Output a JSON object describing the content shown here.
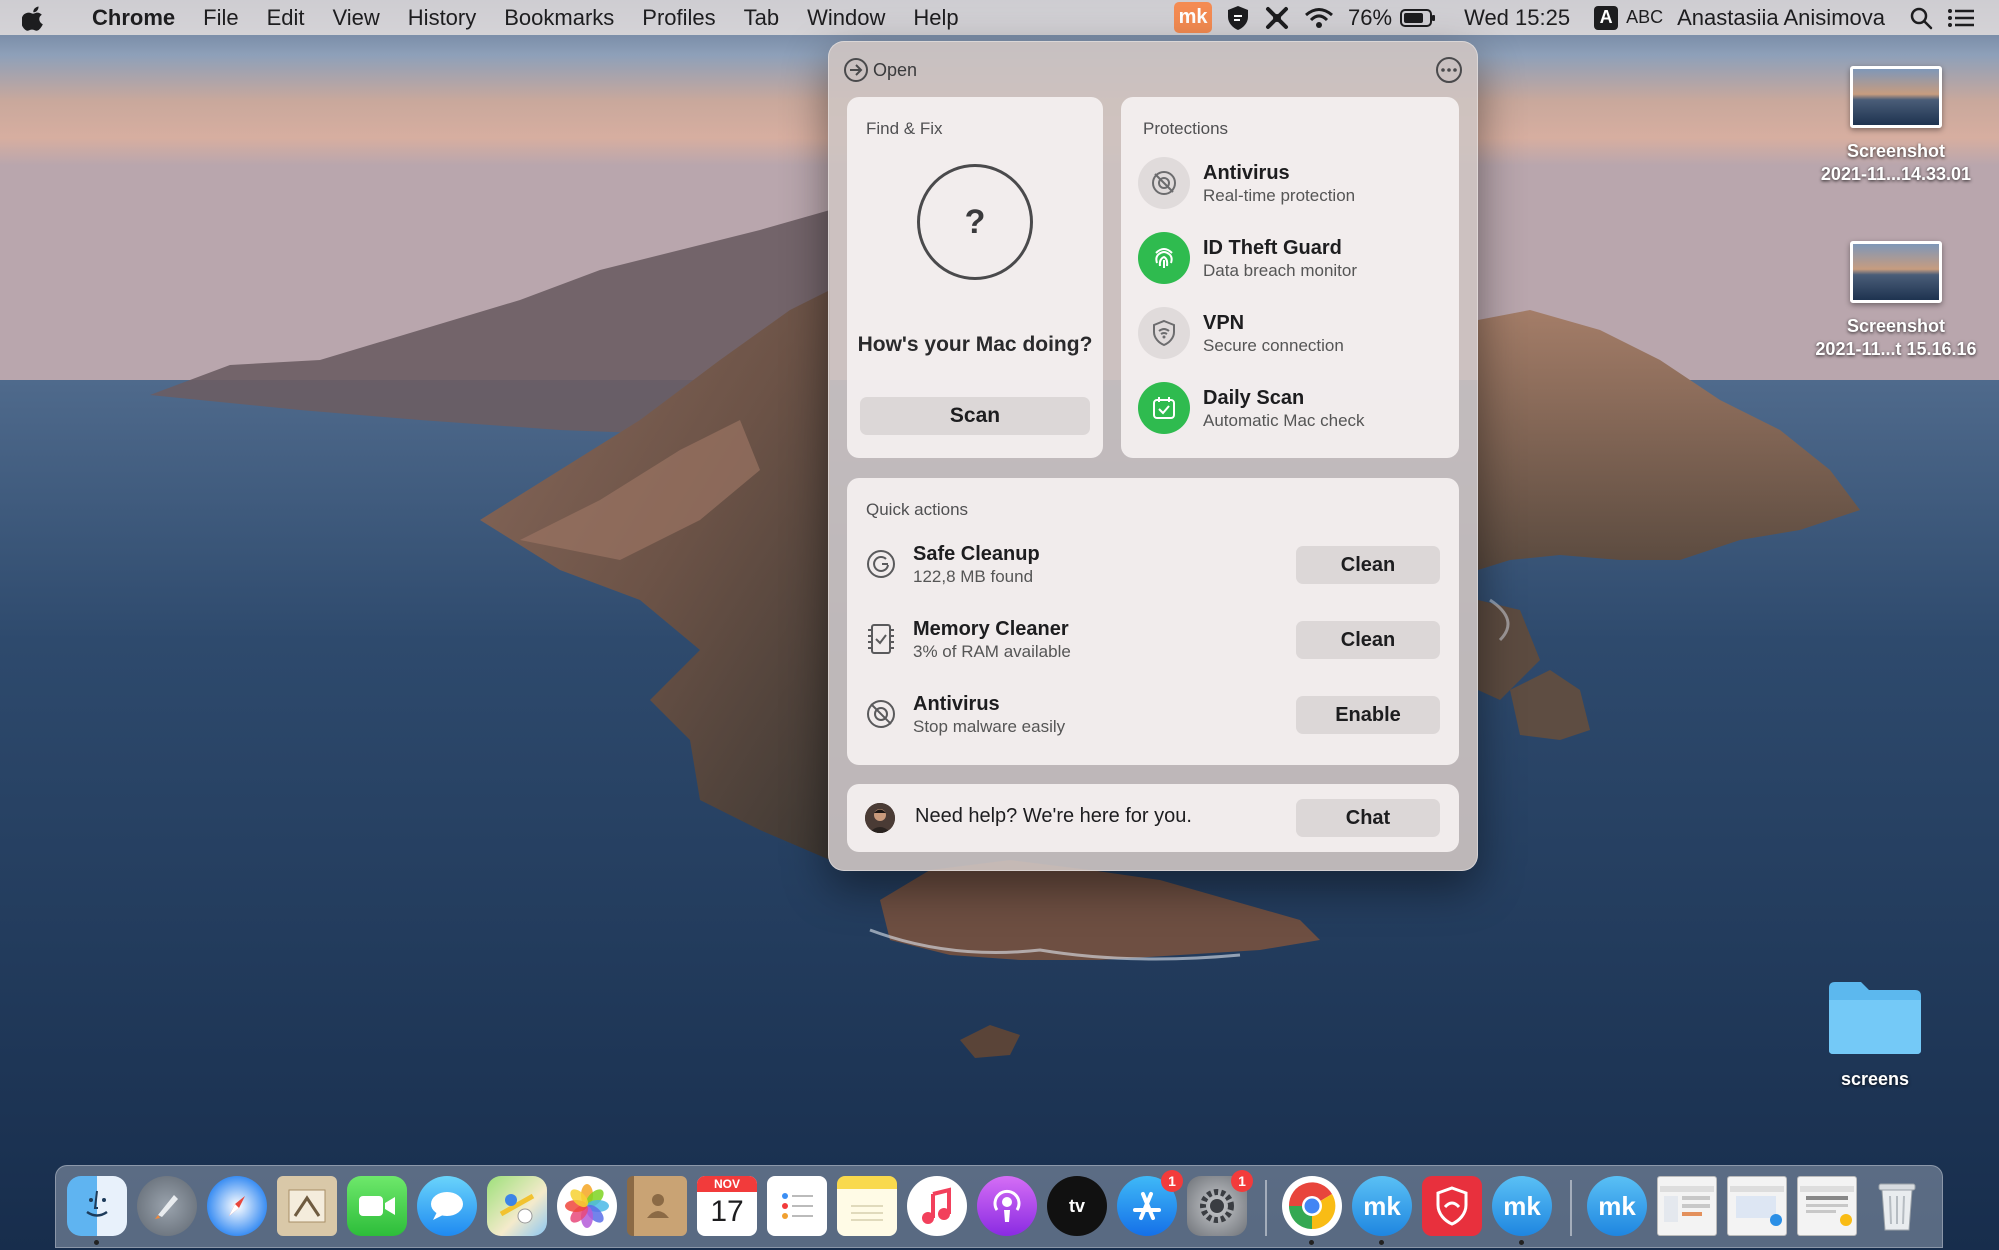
{
  "menubar": {
    "app_name": "Chrome",
    "items": [
      "File",
      "Edit",
      "View",
      "History",
      "Bookmarks",
      "Profiles",
      "Tab",
      "Window",
      "Help"
    ],
    "mk_label": "mk",
    "battery": "76%",
    "clock": "Wed 15:25",
    "input_letter": "A",
    "input_source": "ABC",
    "user": "Anastasiia Anisimova"
  },
  "desktop": {
    "files": [
      {
        "line1": "Screenshot",
        "line2": "2021-11...14.33.01"
      },
      {
        "line1": "Screenshot",
        "line2": "2021-11...t 15.16.16"
      }
    ],
    "folder": "screens"
  },
  "panel": {
    "open_label": "Open",
    "find_fix": {
      "title": "Find & Fix",
      "symbol": "?",
      "question": "How's your Mac doing?",
      "scan_label": "Scan"
    },
    "protections": {
      "title": "Protections",
      "items": [
        {
          "name": "Antivirus",
          "sub": "Real-time protection",
          "active": false
        },
        {
          "name": "ID Theft Guard",
          "sub": "Data breach monitor",
          "active": true
        },
        {
          "name": "VPN",
          "sub": "Secure connection",
          "active": false
        },
        {
          "name": "Daily Scan",
          "sub": "Automatic Mac check",
          "active": true
        }
      ]
    },
    "quick_actions": {
      "title": "Quick actions",
      "items": [
        {
          "name": "Safe Cleanup",
          "sub": "122,8 MB found",
          "button": "Clean"
        },
        {
          "name": "Memory Cleaner",
          "sub": "3% of RAM available",
          "button": "Clean"
        },
        {
          "name": "Antivirus",
          "sub": "Stop malware easily",
          "button": "Enable"
        }
      ]
    },
    "help": {
      "text": "Need help? We're here for you.",
      "button": "Chat"
    }
  },
  "dock": {
    "calendar_month": "NOV",
    "calendar_day": "17",
    "appstore_badge": "1",
    "settings_badge": "1",
    "mk_label": "mk"
  },
  "colors": {
    "accent_green": "#2fbb4f",
    "mk_orange": "#f48b52",
    "mk_blue": "#3aa6e8"
  }
}
